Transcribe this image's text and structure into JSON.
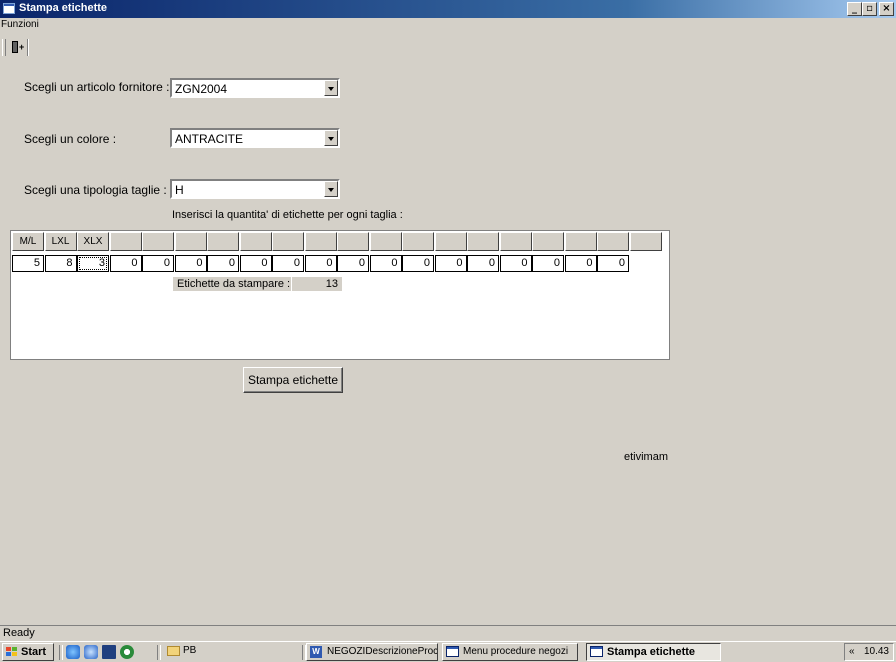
{
  "window": {
    "title": "Stampa etichette",
    "buttons": {
      "minimize": "_",
      "maximize": "▫",
      "close": "×"
    }
  },
  "menu": {
    "items": [
      {
        "label": "Funzioni"
      }
    ]
  },
  "toolbar": {
    "exit_icon": "exit-door-icon"
  },
  "form": {
    "articolo": {
      "label": "Scegli un articolo fornitore :",
      "value": "ZGN2004"
    },
    "colore": {
      "label": "Scegli un colore :",
      "value": "ANTRACITE"
    },
    "taglie": {
      "label": "Scegli una tipologia taglie :",
      "value": "H"
    },
    "instruction": "Inserisci la quantita' di etichette per ogni taglia :"
  },
  "grid": {
    "headers": [
      "M/L",
      "LXL",
      "XLX",
      "",
      "",
      "",
      "",
      "",
      "",
      "",
      "",
      "",
      "",
      "",
      "",
      "",
      "",
      "",
      "",
      ""
    ],
    "quantities": [
      "5",
      "8",
      "3",
      "0",
      "0",
      "0",
      "0",
      "0",
      "0",
      "0",
      "0",
      "0",
      "0",
      "0",
      "0",
      "0",
      "0",
      "0",
      "0"
    ],
    "total_label": "Etichette da stampare :",
    "total_value": "13"
  },
  "print_button": "Stampa etichette",
  "user": "etivimam",
  "status": "Ready",
  "taskbar": {
    "start": "Start",
    "quick_launch": [
      "ie-icon",
      "outlook-icon",
      "desktop-icon",
      "media-player-icon"
    ],
    "folder": "PB",
    "tasks": [
      {
        "label": "NEGOZIDescrizioneProce..."
      },
      {
        "label": "Menu procedure negozi"
      },
      {
        "label": "Stampa etichette"
      }
    ],
    "tray_chevron": "«",
    "clock": "10.43"
  },
  "colors": {
    "titlebar": "#0a246a",
    "face": "#d4d0c8"
  }
}
